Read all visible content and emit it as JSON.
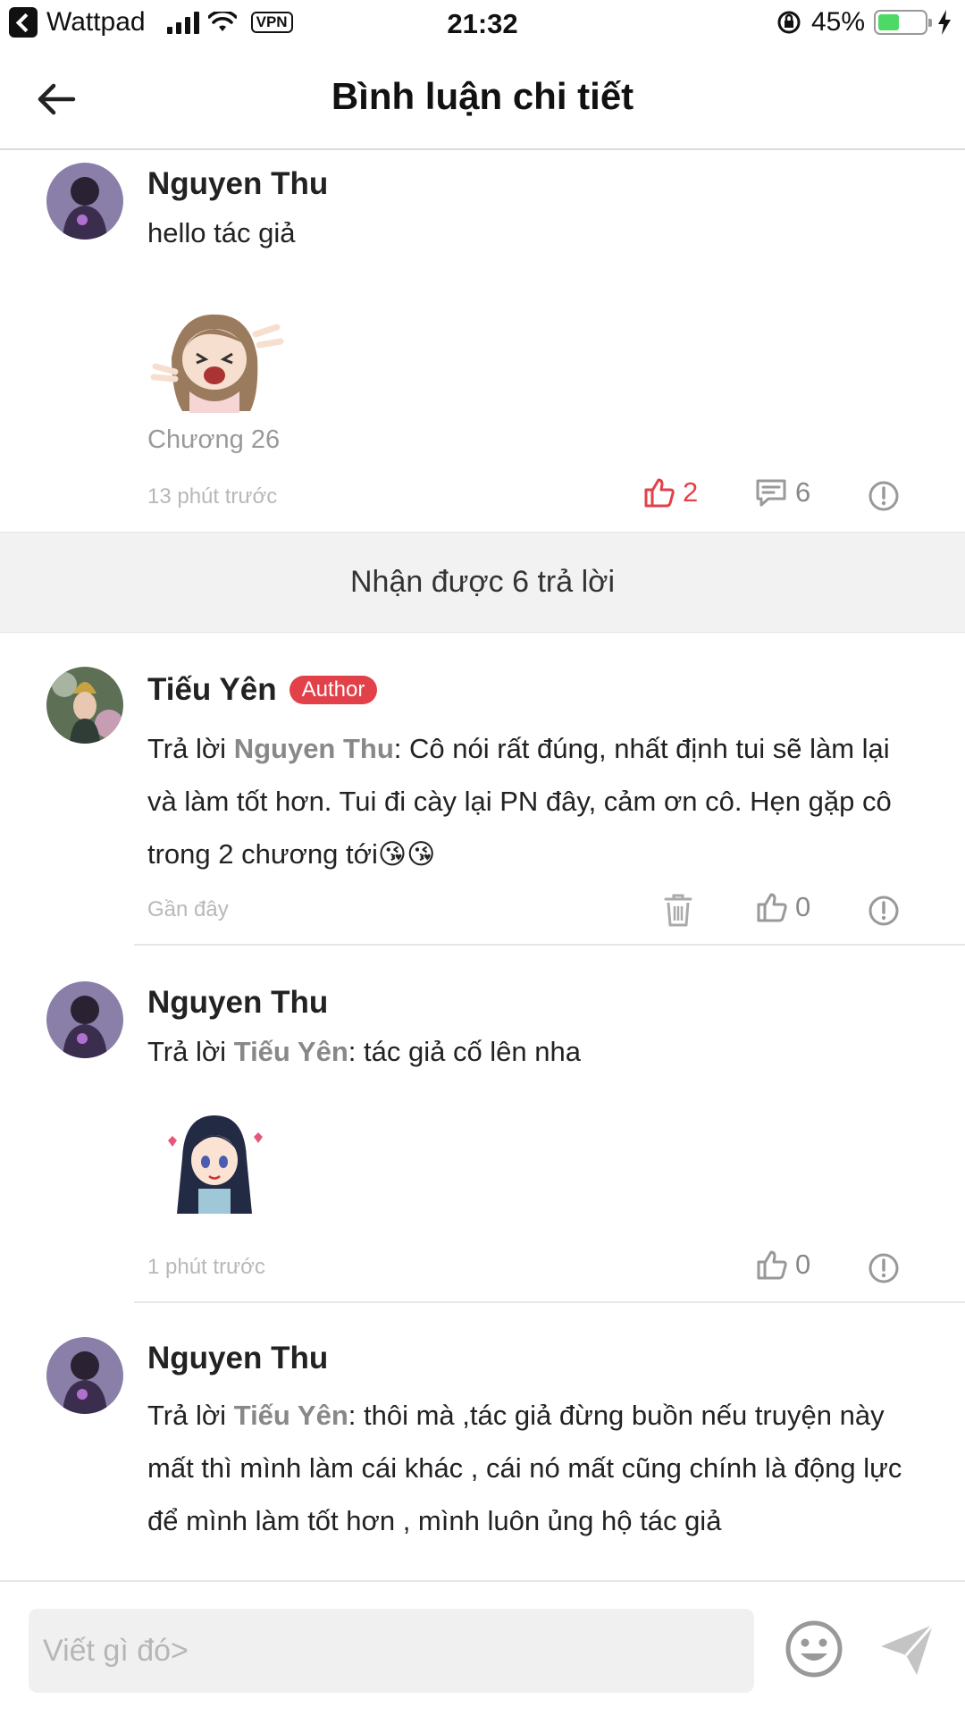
{
  "status_bar": {
    "app_name": "Wattpad",
    "vpn": "VPN",
    "time": "21:32",
    "battery": "45%"
  },
  "header": {
    "title": "Bình luận chi tiết"
  },
  "main_comment": {
    "author": "Nguyen Thu",
    "text": "hello tác giả",
    "chapter": "Chương 26",
    "time": "13 phút trước",
    "likes": "2",
    "replies": "6"
  },
  "replies_summary": "Nhận được 6 trả lời",
  "replies": [
    {
      "author": "Tiếu Yên",
      "badge": "Author",
      "prefix": "Trả lời ",
      "reply_to": "Nguyen Thu",
      "text": ": Cô nói rất đúng, nhất định tui sẽ làm lại và làm tốt hơn. Tui đi cày lại PN đây, cảm ơn cô. Hẹn gặp cô trong 2 chương tới😘😘",
      "time": "Gần đây",
      "likes": "0"
    },
    {
      "author": "Nguyen Thu",
      "prefix": "Trả lời ",
      "reply_to": "Tiếu Yên",
      "text": ": tác giả cố lên nha",
      "time": "1 phút trước",
      "likes": "0"
    },
    {
      "author": "Nguyen Thu",
      "prefix": "Trả lời ",
      "reply_to": "Tiếu Yên",
      "text": ": thôi mà ,tác giả đừng buồn nếu truyện này mất thì mình làm cái khác , cái nó mất cũng chính là động lực để mình làm tốt hơn , mình luôn ủng hộ tác giả"
    }
  ],
  "composer": {
    "placeholder": "Viết gì đó>"
  },
  "colors": {
    "accent": "#e2414a",
    "muted": "#888888",
    "battery": "#4cd964"
  },
  "icons": [
    "back-arrow-icon",
    "like-icon",
    "comment-icon",
    "report-icon",
    "trash-icon",
    "emoji-icon",
    "send-icon"
  ]
}
